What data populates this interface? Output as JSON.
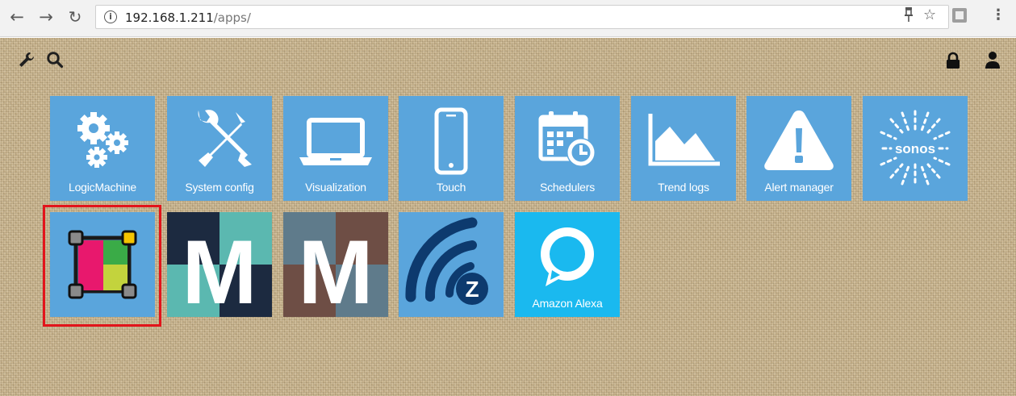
{
  "browser": {
    "url_host": "192.168.1.211",
    "url_path": "/apps/"
  },
  "apps_row1": [
    {
      "label": "LogicMachine",
      "icon": "gears-icon"
    },
    {
      "label": "System config",
      "icon": "tools-icon"
    },
    {
      "label": "Visualization",
      "icon": "laptop-icon"
    },
    {
      "label": "Touch",
      "icon": "smartphone-icon"
    },
    {
      "label": "Schedulers",
      "icon": "calendar-clock-icon"
    },
    {
      "label": "Trend logs",
      "icon": "area-chart-icon"
    },
    {
      "label": "Alert manager",
      "icon": "warning-icon"
    },
    {
      "label": "",
      "icon": "sonos-icon",
      "logo_text": "sonos"
    }
  ],
  "apps_row2": [
    {
      "label": "",
      "icon": "layout-editor-icon",
      "selected": true
    },
    {
      "label": "",
      "icon": "m-logo-teal-icon",
      "logo_text": "M"
    },
    {
      "label": "",
      "icon": "m-logo-brown-icon",
      "logo_text": "M"
    },
    {
      "label": "",
      "icon": "zwave-icon",
      "logo_text": "Z"
    },
    {
      "label": "Amazon Alexa",
      "icon": "alexa-icon"
    }
  ],
  "colors": {
    "tile": "#5aa5dc",
    "alexa": "#1ab9ef",
    "selection": "#e2141b"
  }
}
